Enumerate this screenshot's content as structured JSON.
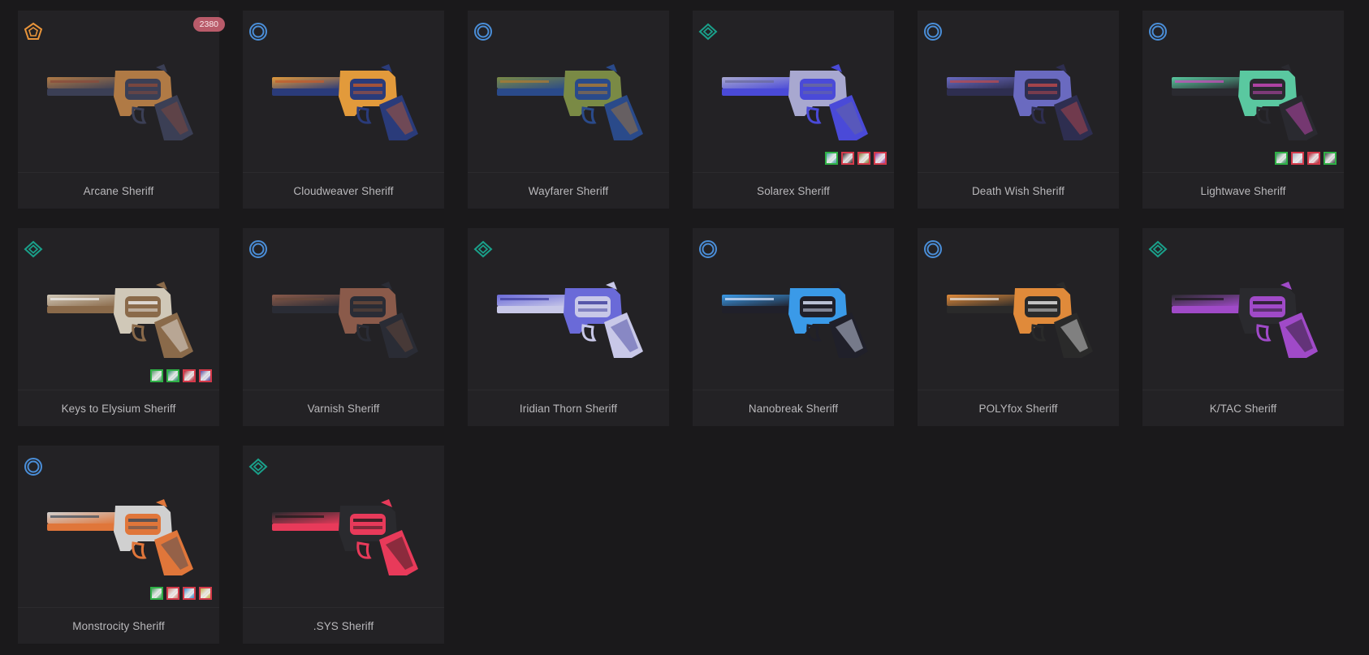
{
  "items": [
    {
      "name": "Arcane Sheriff",
      "tier": "exclusive",
      "price": "2380",
      "colors": [
        "#b07a45",
        "#3b3f55",
        "#8a4a3a"
      ],
      "variants": []
    },
    {
      "name": "Cloudweaver Sheriff",
      "tier": "deluxe",
      "colors": [
        "#e29a3b",
        "#2a3b7a",
        "#c35a2b"
      ],
      "variants": []
    },
    {
      "name": "Wayfarer Sheriff",
      "tier": "deluxe",
      "colors": [
        "#7a8a45",
        "#2a4a8a",
        "#b07a30"
      ],
      "variants": []
    },
    {
      "name": "Solarex Sheriff",
      "tier": "premium",
      "colors": [
        "#a8a8d0",
        "#4a4ad8",
        "#6a6a9a"
      ],
      "variants": [
        {
          "color": "#4aa0a8",
          "active": true
        },
        {
          "color": "#3a2c2f",
          "active": false
        },
        {
          "color": "#8a7a3a",
          "active": false
        },
        {
          "color": "#9a3aa0",
          "active": false
        }
      ]
    },
    {
      "name": "Death Wish Sheriff",
      "tier": "deluxe",
      "colors": [
        "#6a6ac0",
        "#2e2e50",
        "#c04a4a"
      ],
      "variants": []
    },
    {
      "name": "Lightwave Sheriff",
      "tier": "deluxe",
      "colors": [
        "#5ac8a0",
        "#2a2a30",
        "#d04ac0"
      ],
      "variants": [
        {
          "color": "#3a8a60",
          "active": true
        },
        {
          "color": "#a8b0c0",
          "active": false
        },
        {
          "color": "#b02a3a",
          "active": false
        },
        {
          "color": "#4a4a50",
          "active": true
        }
      ]
    },
    {
      "name": "Keys to Elysium Sheriff",
      "tier": "premium",
      "colors": [
        "#d0c8b8",
        "#8a6a4a",
        "#f0f0f0"
      ],
      "variants": [
        {
          "color": "#5a9a70",
          "active": true
        },
        {
          "color": "#2a8a6a",
          "active": true
        },
        {
          "color": "#b02a3a",
          "active": false
        },
        {
          "color": "#5a4aa0",
          "active": false
        }
      ]
    },
    {
      "name": "Varnish Sheriff",
      "tier": "deluxe",
      "colors": [
        "#8a5a4a",
        "#2a2c35",
        "#6a4a3a"
      ],
      "variants": []
    },
    {
      "name": "Iridian Thorn Sheriff",
      "tier": "premium",
      "colors": [
        "#6a6ad8",
        "#c8c8e8",
        "#3a3a9a"
      ],
      "variants": []
    },
    {
      "name": "Nanobreak Sheriff",
      "tier": "deluxe",
      "colors": [
        "#3a9ae8",
        "#20202a",
        "#e0e8ff"
      ],
      "variants": []
    },
    {
      "name": "POLYfox Sheriff",
      "tier": "deluxe",
      "colors": [
        "#e08a3a",
        "#2a2a2a",
        "#e8e8e8"
      ],
      "variants": []
    },
    {
      "name": "K/TAC Sheriff",
      "tier": "premium",
      "colors": [
        "#2a2a2e",
        "#a04ac8",
        "#181818"
      ],
      "variants": []
    },
    {
      "name": "Monstrocity Sheriff",
      "tier": "deluxe",
      "colors": [
        "#d0d0d0",
        "#e0763a",
        "#3a4a5a"
      ],
      "variants": [
        {
          "color": "#4aa060",
          "active": true
        },
        {
          "color": "#d08a7a",
          "active": false
        },
        {
          "color": "#3a90d0",
          "active": false
        },
        {
          "color": "#c8b04a",
          "active": false
        }
      ]
    },
    {
      "name": ".SYS Sheriff",
      "tier": "premium",
      "colors": [
        "#2a2a2e",
        "#e83a5a",
        "#1a1a1a"
      ],
      "variants": []
    }
  ],
  "tier_colors": {
    "exclusive": "#e8943a",
    "deluxe": "#4a8ed8",
    "premium": "#1aa08a"
  }
}
